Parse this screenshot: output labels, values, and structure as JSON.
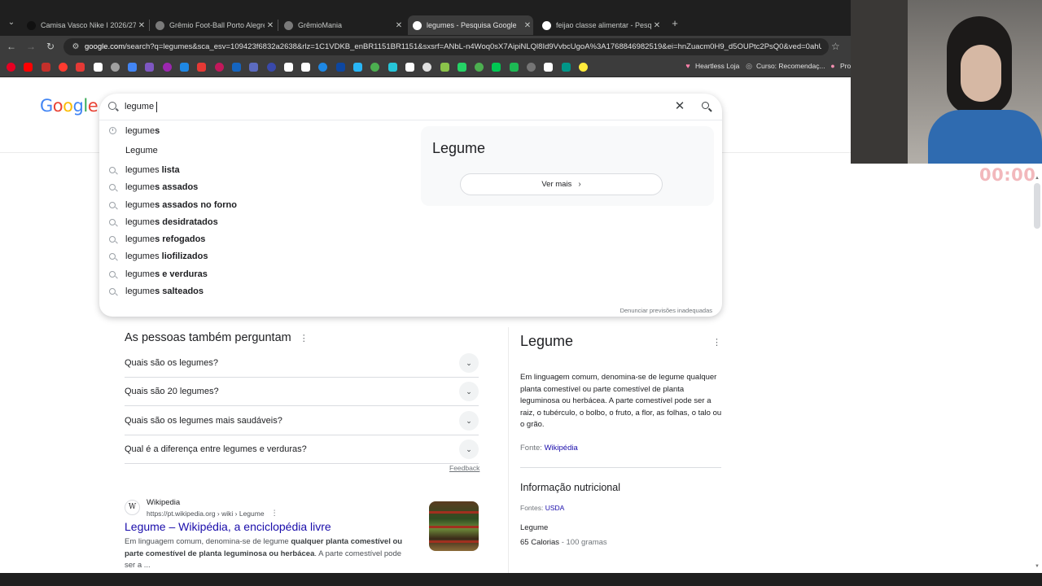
{
  "tabs": [
    {
      "title": "Camisa Vasco Nike I 2026/27 T...",
      "favicon_color": "#111111",
      "active": false
    },
    {
      "title": "Grêmio Foot-Ball Porto Alegren...",
      "favicon_color": "#7a7a7a",
      "active": false
    },
    {
      "title": "GrêmioMania",
      "favicon_color": "#7a7a7a",
      "active": false
    },
    {
      "title": "legumes - Pesquisa Google",
      "favicon_color": "#ffffff",
      "active": true
    },
    {
      "title": "feijao classe alimentar - Pesqui...",
      "favicon_color": "#ffffff",
      "active": false
    }
  ],
  "toolbar": {
    "url_host": "google.com",
    "url_rest": "/search?q=legumes&sca_esv=109423f6832a2638&rlz=1C1VDKB_enBR1151BR1151&sxsrf=ANbL-n4Woq0sX7AipiNLQl8Id9VvbcUgoA%3A1768846982519&ei=hnZuacm0H9_d5OUPtc2PsQ0&ved=0ahUKEwjJj..."
  },
  "bookmarks": {
    "icon_colors": [
      "#e60023",
      "#ff0000",
      "#c4302b",
      "#ff3b30",
      "#e53935",
      "#ffffff",
      "#a0a0a0",
      "#4285f4",
      "#7e57c2",
      "#9c27b0",
      "#1e88e5",
      "#e53935",
      "#c2185b",
      "#1565c0",
      "#5c6bc0",
      "#3949ab",
      "#ffffff",
      "#ffffff",
      "#1e88e5",
      "#0d47a1",
      "#29b6f6",
      "#4caf50",
      "#26c6da",
      "#ffffff",
      "#e0e0e0",
      "#8bc34a",
      "#25d366",
      "#4caf50",
      "#00c853",
      "#1db954",
      "#757575",
      "#ffffff",
      "#009688",
      "#ffeb3b"
    ],
    "named": [
      {
        "label": "Heartless Loja",
        "icon": "♥",
        "color": "#ff80ab"
      },
      {
        "label": "Curso: Recomendaç...",
        "icon": "◎",
        "color": "#bdbdbd"
      },
      {
        "label": "Pro",
        "icon": "●",
        "color": "#f48fb1"
      }
    ]
  },
  "search": {
    "value": "legume",
    "clear_label": "✕",
    "suggestions": [
      {
        "prefix": "legume",
        "suffix": "s",
        "icon": "clock-icon"
      },
      {
        "prefix": "Legume",
        "suffix": "",
        "icon": "none"
      },
      {
        "prefix": "legumes",
        "suffix": " lista",
        "icon": "search-icon"
      },
      {
        "prefix": "legume",
        "suffix": "s assados",
        "icon": "search-icon"
      },
      {
        "prefix": "legume",
        "suffix": "s assados no forno",
        "icon": "search-icon"
      },
      {
        "prefix": "legume",
        "suffix": "s desidratados",
        "icon": "search-icon"
      },
      {
        "prefix": "legume",
        "suffix": "s refogados",
        "icon": "search-icon"
      },
      {
        "prefix": "legumes",
        "suffix": " liofilizados",
        "icon": "search-icon"
      },
      {
        "prefix": "legume",
        "suffix": "s e verduras",
        "icon": "search-icon"
      },
      {
        "prefix": "legume",
        "suffix": "s salteados",
        "icon": "search-icon"
      }
    ],
    "entity_title": "Legume",
    "ver_mais": "Ver mais",
    "report_label": "Denunciar previsões inadequadas"
  },
  "paa": {
    "title": "As pessoas também perguntam",
    "questions": [
      "Quais são os legumes?",
      "Quais são 20 legumes?",
      "Quais são os legumes mais saudáveis?",
      "Qual é a diferença entre legumes e verduras?"
    ],
    "feedback": "Feedback"
  },
  "result": {
    "site": "Wikipedia",
    "url": "https://pt.wikipedia.org › wiki › Legume",
    "title": "Legume – Wikipédia, a enciclopédia livre",
    "snippet_a": "Em linguagem comum, denomina-se de legume ",
    "snippet_b": "qualquer planta comestível ou parte comestível de planta leguminosa ou herbácea",
    "snippet_c": ". A parte comestível pode ser a ..."
  },
  "knowledge": {
    "title": "Legume",
    "description": "Em linguagem comum, denomina-se de legume qualquer planta comestível ou parte comestível de planta leguminosa ou herbácea. A parte comestível pode ser a raiz, o tubérculo, o bolbo, o fruto, a flor, as folhas, o talo ou o grão.",
    "source_label": "Fonte: ",
    "source_link": "Wikipédia",
    "nutrition_title": "Informação nutricional",
    "fontes_label": "Fontes: ",
    "fontes_link": "USDA",
    "item": "Legume",
    "calories": "65 Calorias",
    "per": " - 100 gramas"
  },
  "overlay": {
    "timer": "00:00"
  }
}
